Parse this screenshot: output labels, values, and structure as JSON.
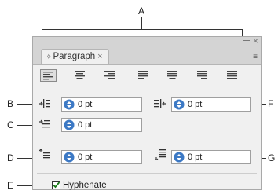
{
  "callouts": {
    "a": "A",
    "b": "B",
    "c": "C",
    "d": "D",
    "e": "E",
    "f": "F",
    "g": "G"
  },
  "panel": {
    "tab_label": "Paragraph",
    "tab_close": "×",
    "close_glyph": "×",
    "menu_glyph": "≡",
    "alignment": {
      "buttons": [
        "align-left",
        "align-center",
        "align-right",
        "justify-last-left",
        "justify-last-center",
        "justify-last-right",
        "justify-all"
      ],
      "selected": "align-left"
    },
    "left_indent": "0 pt",
    "right_indent": "0 pt",
    "first_line_indent": "0 pt",
    "space_before": "0 pt",
    "space_after": "0 pt",
    "hyphenate_label": "Hyphenate",
    "hyphenate_checked": true
  },
  "colors": {
    "panel_bg": "#f0f0f0",
    "tabstrip_bg": "#d4d4d4",
    "spinner_blue": "#3c79c5"
  }
}
